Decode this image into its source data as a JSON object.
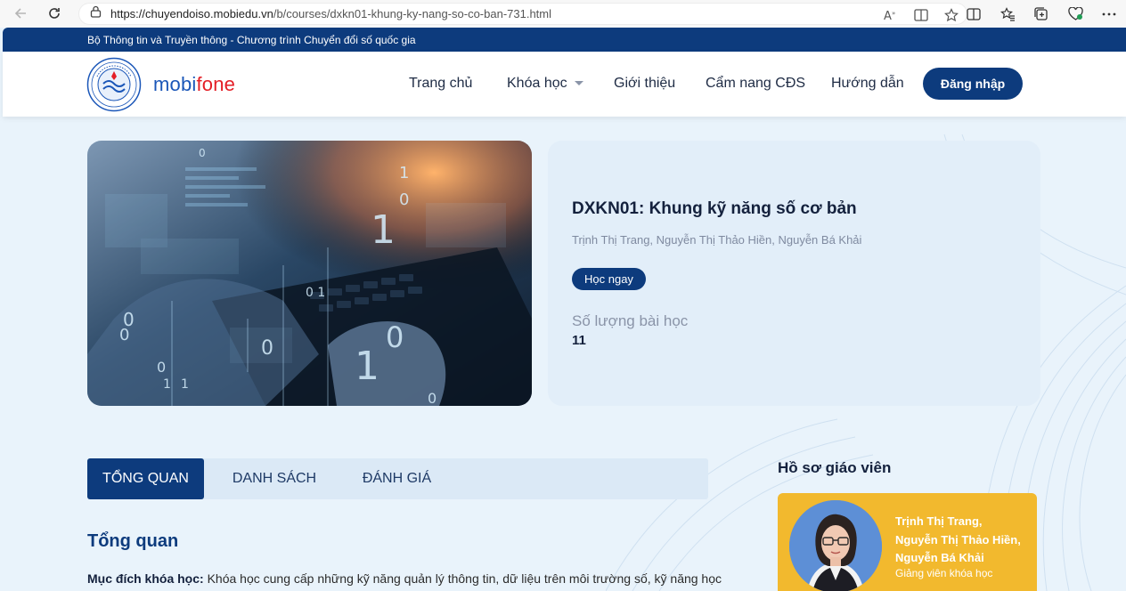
{
  "browser": {
    "url_host": "https://chuyendoiso.mobiedu.vn",
    "url_path": "/b/courses/dxkn01-khung-ky-nang-so-co-ban-731.html"
  },
  "banner": {
    "text": "Bộ Thông tin và Truyền thông - Chương trình Chuyển đổi số quốc gia"
  },
  "header": {
    "brand_part1": "mobi",
    "brand_part2": "fone",
    "nav": [
      "Trang chủ",
      "Khóa học",
      "Giới thiệu",
      "Cẩm nang CĐS",
      "Hướng dẫn"
    ],
    "login_label": "Đăng nhập"
  },
  "course": {
    "title": "DXKN01: Khung kỹ năng số cơ bản",
    "authors": "Trịnh Thị Trang, Nguyễn Thị Thảo Hiền, Nguyễn Bá Khải",
    "learn_label": "Học ngay",
    "lesson_label": "Số lượng bài học",
    "lesson_count": "11"
  },
  "tabs": [
    "TỔNG QUAN",
    "DANH SÁCH",
    "ĐÁNH GIÁ"
  ],
  "overview": {
    "heading": "Tổng quan",
    "purpose_label": "Mục đích khóa học:",
    "purpose_text": " Khóa học cung cấp những kỹ năng quản lý thông tin, dữ liệu trên môi trường số, kỹ năng học"
  },
  "teacher": {
    "heading": "Hồ sơ giáo viên",
    "name_line1": "Trịnh Thị Trang,",
    "name_line2": "Nguyễn Thị Thảo Hiền,",
    "name_line3": "Nguyễn Bá Khải",
    "role": "Giảng viên khóa học"
  },
  "colors": {
    "primary": "#0d3b7d",
    "brand_blue": "#1a56b8",
    "brand_red": "#e41e26",
    "teacher_card": "#f2b92e"
  }
}
